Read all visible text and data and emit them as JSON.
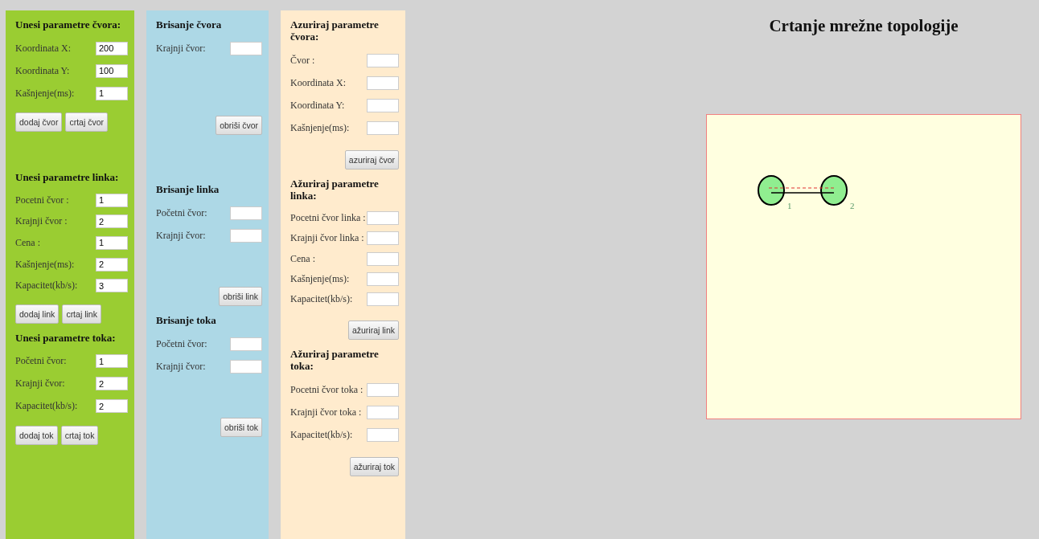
{
  "columns": [
    {
      "color": "#9acd32",
      "sections": [
        {
          "heading": "Unesi parametre čvora:",
          "fields": [
            {
              "label": "Koordinata X:",
              "value": "200"
            },
            {
              "label": "Koordinata Y:",
              "value": "100"
            },
            {
              "label": "Kašnjenje(ms):",
              "value": "1"
            }
          ],
          "buttons": [
            "dodaj čvor",
            "crtaj čvor"
          ]
        },
        {
          "heading": "Unesi parametre linka:",
          "fields": [
            {
              "label": "Pocetni čvor :",
              "value": "1"
            },
            {
              "label": "Krajnji čvor :",
              "value": "2"
            },
            {
              "label": "Cena :",
              "value": "1"
            },
            {
              "label": "Kašnjenje(ms):",
              "value": "2"
            },
            {
              "label": "Kapacitet(kb/s):",
              "value": "3"
            }
          ],
          "buttons": [
            "dodaj link",
            "crtaj link"
          ]
        },
        {
          "heading": "Unesi parametre toka:",
          "fields": [
            {
              "label": "Početni čvor:",
              "value": "1"
            },
            {
              "label": "Krajnji čvor:",
              "value": "2"
            },
            {
              "label": "Kapacitet(kb/s):",
              "value": "2"
            }
          ],
          "buttons": [
            "dodaj tok",
            "crtaj tok"
          ]
        }
      ]
    },
    {
      "color": "#add8e6",
      "sections": [
        {
          "heading": "Brisanje čvora",
          "fields": [
            {
              "label": "Krajnji čvor:"
            }
          ],
          "buttons": [
            "obriši čvor"
          ]
        },
        {
          "heading": "Brisanje linka",
          "fields": [
            {
              "label": "Početni čvor:"
            },
            {
              "label": "Krajnji čvor:"
            }
          ],
          "buttons": [
            "obriši link"
          ]
        },
        {
          "heading": "Brisanje toka",
          "fields": [
            {
              "label": "Početni čvor:"
            },
            {
              "label": "Krajnji čvor:"
            }
          ],
          "buttons": [
            "obriši tok"
          ]
        }
      ]
    },
    {
      "color": "#ffebcd",
      "sections": [
        {
          "heading": "Azuriraj parametre čvora:",
          "fields": [
            {
              "label": "Čvor :"
            },
            {
              "label": "Koordinata X:"
            },
            {
              "label": "Koordinata Y:"
            },
            {
              "label": "Kašnjenje(ms):"
            }
          ],
          "buttons": [
            "azuriraj čvor"
          ]
        },
        {
          "heading": "Ažuriraj parametre linka:",
          "fields": [
            {
              "label": "Pocetni čvor linka :"
            },
            {
              "label": "Krajnji čvor linka :"
            },
            {
              "label": "Cena :"
            },
            {
              "label": "Kašnjenje(ms):"
            },
            {
              "label": "Kapacitet(kb/s):"
            }
          ],
          "buttons": [
            "ažuriraj link"
          ]
        },
        {
          "heading": "Ažuriraj parametre toka:",
          "fields": [
            {
              "label": "Pocetni čvor toka :"
            },
            {
              "label": "Krajnji čvor toka :"
            },
            {
              "label": "Kapacitet(kb/s):"
            }
          ],
          "buttons": [
            "ažuriraj tok"
          ]
        }
      ]
    }
  ],
  "topology": {
    "title": "Crtanje mrežne topologije",
    "nodes": [
      {
        "label": "1"
      },
      {
        "label": "2"
      }
    ]
  }
}
